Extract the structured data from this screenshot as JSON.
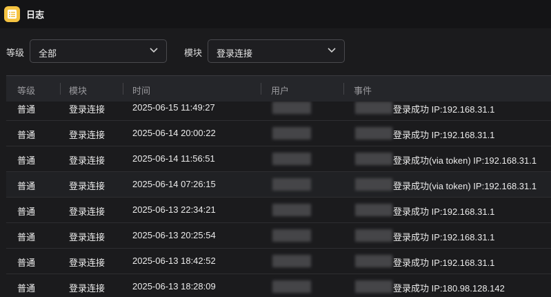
{
  "window": {
    "title": "日志",
    "icon": "log-list-icon"
  },
  "filters": {
    "level_label": "等级",
    "level_value": "全部",
    "module_label": "模块",
    "module_value": "登录连接"
  },
  "table": {
    "columns": [
      "等级",
      "模块",
      "时间",
      "用户",
      "事件"
    ],
    "rows": [
      {
        "level": "普通",
        "module": "登录连接",
        "time": "2025-06-15 11:49:27",
        "event": "登录成功 IP:192.168.31.1"
      },
      {
        "level": "普通",
        "module": "登录连接",
        "time": "2025-06-14 20:00:22",
        "event": "登录成功 IP:192.168.31.1"
      },
      {
        "level": "普通",
        "module": "登录连接",
        "time": "2025-06-14 11:56:51",
        "event": "登录成功(via token) IP:192.168.31.1"
      },
      {
        "level": "普通",
        "module": "登录连接",
        "time": "2025-06-14 07:26:15",
        "event": "登录成功(via token) IP:192.168.31.1"
      },
      {
        "level": "普通",
        "module": "登录连接",
        "time": "2025-06-13 22:34:21",
        "event": "登录成功 IP:192.168.31.1"
      },
      {
        "level": "普通",
        "module": "登录连接",
        "time": "2025-06-13 20:25:54",
        "event": "登录成功 IP:192.168.31.1"
      },
      {
        "level": "普通",
        "module": "登录连接",
        "time": "2025-06-13 18:42:52",
        "event": "登录成功 IP:192.168.31.1"
      },
      {
        "level": "普通",
        "module": "登录连接",
        "time": "2025-06-13 18:28:09",
        "event": "登录成功 IP:180.98.128.142"
      }
    ]
  }
}
